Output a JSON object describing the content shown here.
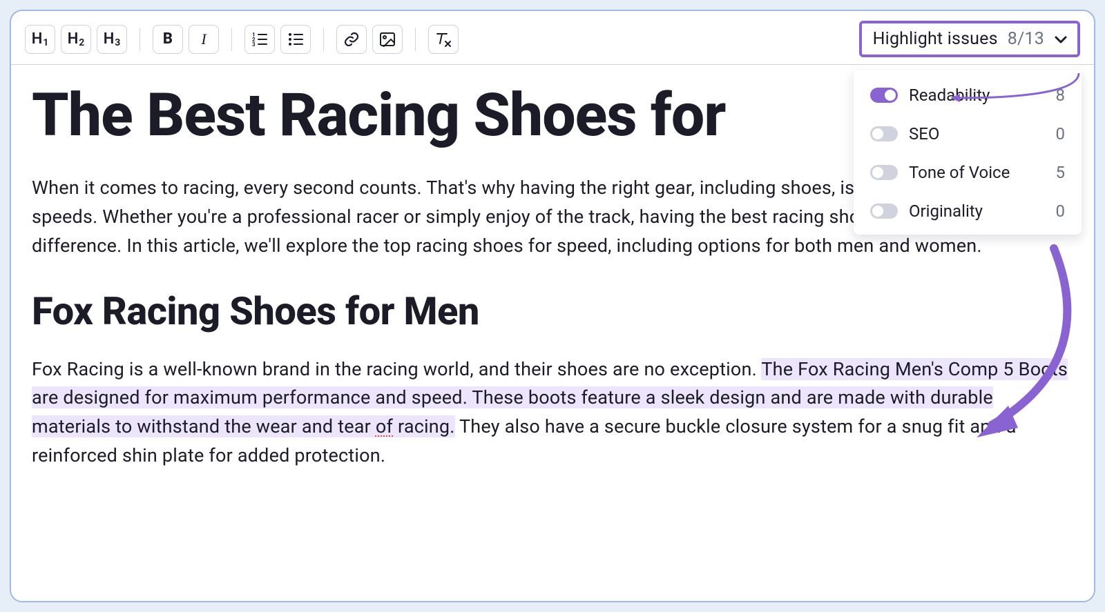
{
  "toolbar": {
    "h1": "H",
    "h1_sub": "1",
    "h2": "H",
    "h2_sub": "2",
    "h3": "H",
    "h3_sub": "3",
    "bold": "B",
    "italic": "I"
  },
  "highlight_issues": {
    "label": "Highlight issues",
    "count": "8/13",
    "options": [
      {
        "name": "Readability",
        "enabled": true,
        "value": 8
      },
      {
        "name": "SEO",
        "enabled": false,
        "value": 0
      },
      {
        "name": "Tone of Voice",
        "enabled": false,
        "value": 5
      },
      {
        "name": "Originality",
        "enabled": false,
        "value": 0
      }
    ]
  },
  "document": {
    "title": "The Best Racing Shoes for",
    "intro_text": "When it comes to racing, every second counts. That's why having the right gear, including shoes, is crucial for achieving top speeds. Whether you're a professional racer or simply enjoy of the track, having the best racing shoes can make all the difference. In this article, we'll explore the top racing shoes for speed, including options for both men and women.",
    "section1_heading": "Fox Racing Shoes for Men",
    "section1_pre": "Fox Racing is a well-known brand in the racing world, and their shoes are no exception. ",
    "section1_hl": "The Fox Racing Men's Comp 5 Boots are designed for maximum performance and speed. These boots feature a sleek design and are made with durable materials to withstand the wear and tear ",
    "section1_spell": "of",
    "section1_hl_tail": " racing.",
    "section1_post": " They also have a secure buckle closure system for a snug fit and a reinforced shin plate for added protection."
  },
  "colors": {
    "accent": "#8a63d2",
    "highlight": "#ece5fc"
  }
}
